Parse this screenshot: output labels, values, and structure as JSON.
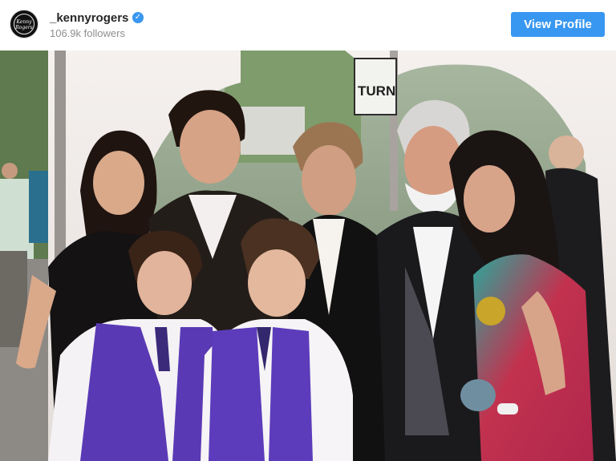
{
  "post_header": {
    "avatar_icon": "kenny-rogers-logo",
    "avatar_text": "Kenny Rogers",
    "username": "_kennyrogers",
    "verified_icon": "verified-badge-icon",
    "followers": "106.9k followers",
    "view_profile_label": "View Profile",
    "accent_color": "#3897f0"
  },
  "photo": {
    "sign_text": "TURN"
  }
}
